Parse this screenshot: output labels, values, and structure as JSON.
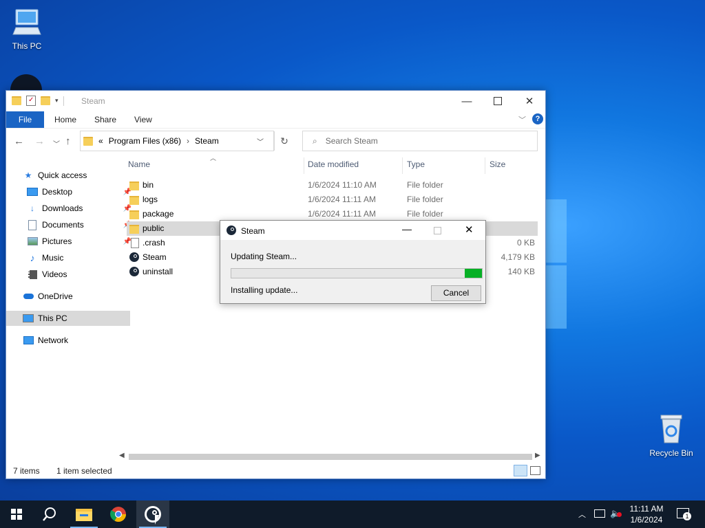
{
  "desktop": {
    "icons": [
      {
        "label": "This PC",
        "icon": "this-pc-icon"
      },
      {
        "label": "Recycle Bin",
        "icon": "recycle-bin-icon"
      }
    ]
  },
  "explorer": {
    "title": "Steam",
    "ribbon_tabs": [
      "File",
      "Home",
      "Share",
      "View"
    ],
    "address": {
      "overflow": "«",
      "segments": [
        "Program Files (x86)",
        "Steam"
      ]
    },
    "search": {
      "placeholder": "Search Steam"
    },
    "sidebar": [
      {
        "label": "Quick access",
        "icon": "star-icon"
      },
      {
        "label": "Desktop",
        "icon": "desktop-folder-icon",
        "pinned": true
      },
      {
        "label": "Downloads",
        "icon": "downloads-icon",
        "pinned": true
      },
      {
        "label": "Documents",
        "icon": "documents-icon",
        "pinned": true
      },
      {
        "label": "Pictures",
        "icon": "pictures-icon",
        "pinned": true
      },
      {
        "label": "Music",
        "icon": "music-icon"
      },
      {
        "label": "Videos",
        "icon": "videos-icon"
      },
      {
        "label": "OneDrive",
        "icon": "onedrive-icon"
      },
      {
        "label": "This PC",
        "icon": "this-pc-icon",
        "selected": true
      },
      {
        "label": "Network",
        "icon": "network-icon"
      }
    ],
    "columns": {
      "name": "Name",
      "date": "Date modified",
      "type": "Type",
      "size": "Size"
    },
    "files": [
      {
        "name": "bin",
        "date": "1/6/2024 11:10 AM",
        "type": "File folder",
        "size": "",
        "icon": "folder-icon"
      },
      {
        "name": "logs",
        "date": "1/6/2024 11:11 AM",
        "type": "File folder",
        "size": "",
        "icon": "folder-icon"
      },
      {
        "name": "package",
        "date": "1/6/2024 11:11 AM",
        "type": "File folder",
        "size": "",
        "icon": "folder-icon"
      },
      {
        "name": "public",
        "date": "",
        "type": "",
        "size": "",
        "icon": "folder-icon",
        "selected": true
      },
      {
        "name": ".crash",
        "date": "",
        "type": "",
        "size": "0 KB",
        "icon": "file-icon"
      },
      {
        "name": "Steam",
        "date": "",
        "type": "",
        "size": "4,179 KB",
        "icon": "steam-icon"
      },
      {
        "name": "uninstall",
        "date": "",
        "type": "",
        "size": "140 KB",
        "icon": "steam-icon"
      }
    ],
    "status": {
      "items": "7 items",
      "selected": "1 item selected"
    }
  },
  "dialog": {
    "title": "Steam",
    "message": "Updating Steam...",
    "progress": 0.07,
    "status": "Installing update...",
    "cancel_label": "Cancel",
    "progress_color": "#06b025"
  },
  "taskbar": {
    "time": "11:11 AM",
    "date": "1/6/2024",
    "notification_count": "1",
    "apps": [
      "windows-start-icon",
      "search-icon",
      "file-explorer-icon",
      "chrome-icon",
      "steam-icon"
    ]
  }
}
